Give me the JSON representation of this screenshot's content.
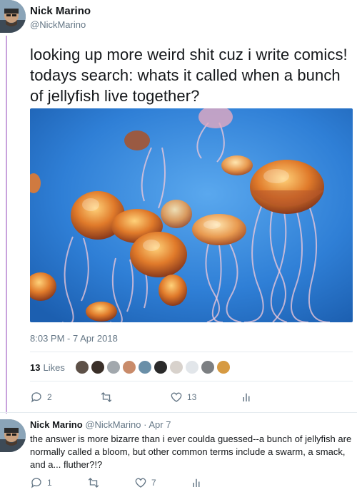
{
  "tweet": {
    "author_name": "Nick Marino",
    "author_handle": "@NickMarino",
    "text": "looking up more weird shit cuz i write comics! todays search: whats it called when a bunch of jellyfish live together?",
    "timestamp": "8:03 PM - 7 Apr 2018",
    "likes_count": "13",
    "likes_label": "Likes",
    "actions": {
      "reply_count": "2",
      "retweet_count": "",
      "like_count": "13"
    }
  },
  "reply": {
    "author_name": "Nick Marino",
    "author_handle": "@NickMarino",
    "date": "· Apr 7",
    "text": "the answer is more bizarre than i ever coulda guessed--a bunch of jellyfish are normally called a bloom, but other common terms include a swarm, a smack, and a... fluther?!?",
    "actions": {
      "reply_count": "1",
      "retweet_count": "",
      "like_count": "7"
    }
  },
  "colors": {
    "thread_line": "#c8a2dc",
    "text_primary": "#14171a",
    "text_secondary": "#657786",
    "divider": "#e6ecf0",
    "ocean_blue": "#2f7fd6"
  },
  "icons": [
    "reply-icon",
    "retweet-icon",
    "like-icon",
    "analytics-icon"
  ]
}
